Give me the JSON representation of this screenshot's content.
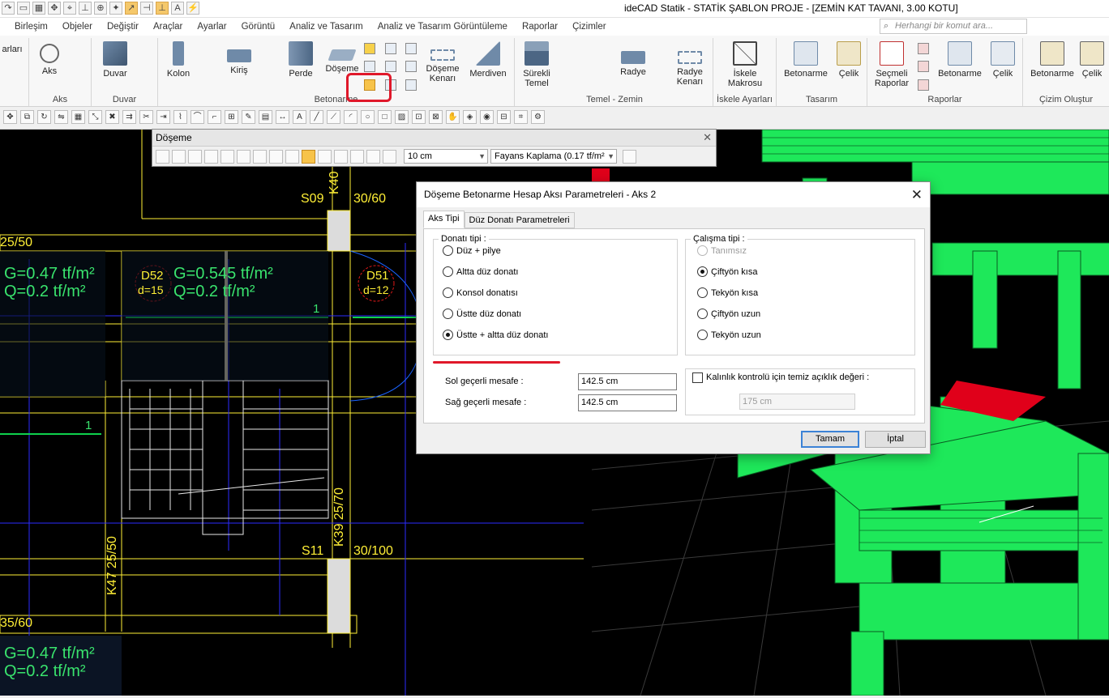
{
  "window": {
    "title": "ideCAD Statik - STATİK ŞABLON PROJE - [ZEMİN KAT TAVANI,  3.00 KOTU]"
  },
  "menubar": {
    "items": [
      "Birleşim",
      "Objeler",
      "Değiştir",
      "Araçlar",
      "Ayarlar",
      "Görüntü",
      "Analiz ve Tasarım",
      "Analiz ve Tasarım Görüntüleme",
      "Raporlar",
      "Çizimler"
    ],
    "search_placeholder": "Herhangi bir komut ara..."
  },
  "ribbon": {
    "groups": [
      {
        "label": "Aks",
        "buttons": [
          "Aks"
        ]
      },
      {
        "label": "Duvar",
        "buttons": [
          "Duvar"
        ]
      },
      {
        "label": "Betonarme",
        "buttons": [
          "Kolon",
          "Kiriş",
          "Perde",
          "Döşeme",
          "Döşeme Kenarı",
          "Merdiven"
        ]
      },
      {
        "label": "Temel - Zemin",
        "buttons": [
          "Sürekli Temel",
          "Radye",
          "Radye Kenarı"
        ]
      },
      {
        "label": "İskele Ayarları",
        "buttons": [
          "İskele Makrosu"
        ]
      },
      {
        "label": "Tasarım",
        "buttons": [
          "Betonarme",
          "Çelik"
        ]
      },
      {
        "label": "Raporlar",
        "buttons": [
          "Seçmeli Raporlar",
          "Betonarme",
          "Çelik"
        ]
      },
      {
        "label": "Çizim Oluştur",
        "buttons": [
          "Betonarme",
          "Çelik"
        ]
      }
    ],
    "partial_left": "arları"
  },
  "doseme_toolbar": {
    "title": "Döşeme",
    "thickness": "10 cm",
    "load": "Fayans Kaplama (0.17 tf/m²"
  },
  "cad": {
    "labels": {
      "s09": "S09",
      "k40": "K40",
      "b3060": "30/60",
      "b2550": "25/50",
      "g1": "G=0.47 tf/m²",
      "q1": "Q=0.2 tf/m²",
      "d52": "D52",
      "d52t": "d=15",
      "g2": "G=0.545 tf/m²",
      "q2": "Q=0.2 tf/m²",
      "d51": "D51",
      "d51t": "d=12",
      "one": "1",
      "k39": "K39 25/70",
      "s11": "S11",
      "b30100": "30/100",
      "k47": "K47 25/50",
      "b3560": "35/60",
      "g3": "G=0.47 tf/m²",
      "q3": "Q=0.2 tf/m²"
    }
  },
  "dialog": {
    "title": "Döşeme Betonarme Hesap Aksı Parametreleri - Aks 2",
    "tabs": [
      "Aks Tipi",
      "Düz Donatı Parametreleri"
    ],
    "donati_tipi": {
      "legend": "Donatı tipi :",
      "options": [
        "Düz + pilye",
        "Altta düz donatı",
        "Konsol donatısı",
        "Üstte düz donatı",
        "Üstte + altta düz donatı"
      ],
      "selected": "Üstte + altta düz donatı"
    },
    "calisma_tipi": {
      "legend": "Çalışma tipi :",
      "options": [
        "Tanımsız",
        "Çiftyön kısa",
        "Tekyön kısa",
        "Çiftyön uzun",
        "Tekyön uzun"
      ],
      "selected": "Çiftyön kısa",
      "disabled": [
        "Tanımsız"
      ]
    },
    "sol_label": "Sol geçerli mesafe :",
    "sol_value": "142.5 cm",
    "sag_label": "Sağ geçerli mesafe :",
    "sag_value": "142.5 cm",
    "kalinlik_label": "Kalınlık kontrolü için temiz açıklık değeri :",
    "kalinlik_value": "175 cm",
    "kalinlik_checked": false,
    "ok_label": "Tamam",
    "cancel_label": "İptal"
  },
  "colors": {
    "accent_red": "#e0182a",
    "cad_yellow": "#ffef36",
    "cad_green": "#39e36d",
    "model_green": "#1ee85a"
  }
}
